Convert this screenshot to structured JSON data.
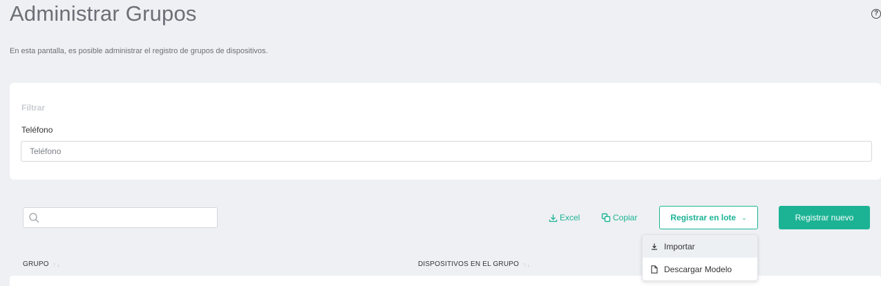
{
  "header": {
    "title": "Administrar Grupos",
    "description": "En esta pantalla, es posible administrar el registro de grupos de dispositivos.",
    "help_icon": "?"
  },
  "filter": {
    "title": "Filtrar",
    "phone_label": "Teléfono",
    "phone_placeholder": "Teléfono",
    "phone_value": ""
  },
  "toolbar": {
    "search_placeholder": "",
    "search_value": "",
    "excel_label": "Excel",
    "copy_label": "Copiar",
    "batch_label": "Registrar en lote",
    "batch_chevron": "⌄",
    "new_label": "Registrar nuevo",
    "accent_color": "#1cb394"
  },
  "dropdown": {
    "items": [
      {
        "label": "Importar",
        "icon": "download-icon",
        "active": true
      },
      {
        "label": "Descargar Modelo",
        "icon": "file-icon",
        "active": false
      }
    ]
  },
  "table": {
    "columns": [
      {
        "label": "GRUPO",
        "sort_icon": "↑↓"
      },
      {
        "label": "DISPOSITIVOS EN EL GRUPO",
        "sort_icon": "↑↓"
      }
    ]
  }
}
